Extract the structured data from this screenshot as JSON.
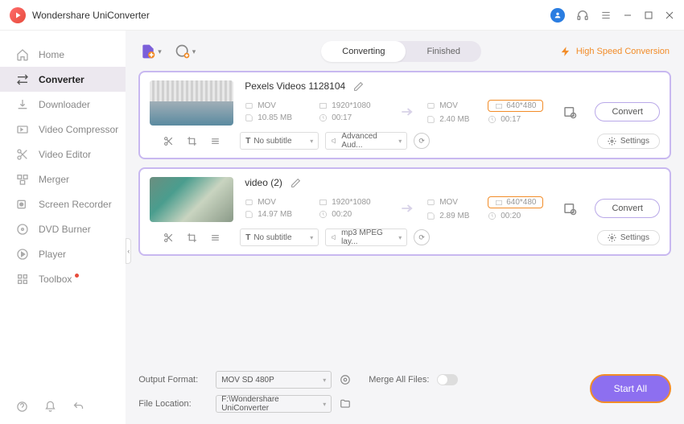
{
  "app": {
    "title": "Wondershare UniConverter"
  },
  "sidebar": {
    "items": [
      {
        "label": "Home"
      },
      {
        "label": "Converter"
      },
      {
        "label": "Downloader"
      },
      {
        "label": "Video Compressor"
      },
      {
        "label": "Video Editor"
      },
      {
        "label": "Merger"
      },
      {
        "label": "Screen Recorder"
      },
      {
        "label": "DVD Burner"
      },
      {
        "label": "Player"
      },
      {
        "label": "Toolbox"
      }
    ]
  },
  "toolbar": {
    "tabs": {
      "converting": "Converting",
      "finished": "Finished"
    },
    "hsc": "High Speed Conversion"
  },
  "items": [
    {
      "name": "Pexels Videos 1128104",
      "in": {
        "fmt": "MOV",
        "res": "1920*1080",
        "size": "10.85 MB",
        "dur": "00:17"
      },
      "out": {
        "fmt": "MOV",
        "res": "640*480",
        "size": "2.40 MB",
        "dur": "00:17"
      },
      "subtitle": "No subtitle",
      "audio": "Advanced Aud...",
      "convert": "Convert",
      "settings": "Settings"
    },
    {
      "name": "video (2)",
      "in": {
        "fmt": "MOV",
        "res": "1920*1080",
        "size": "14.97 MB",
        "dur": "00:20"
      },
      "out": {
        "fmt": "MOV",
        "res": "640*480",
        "size": "2.89 MB",
        "dur": "00:20"
      },
      "subtitle": "No subtitle",
      "audio": "mp3 MPEG lay...",
      "convert": "Convert",
      "settings": "Settings"
    }
  ],
  "footer": {
    "output_format_label": "Output Format:",
    "output_format": "MOV SD 480P",
    "file_location_label": "File Location:",
    "file_location": "F:\\Wondershare UniConverter",
    "merge_label": "Merge All Files:",
    "start_all": "Start All"
  }
}
